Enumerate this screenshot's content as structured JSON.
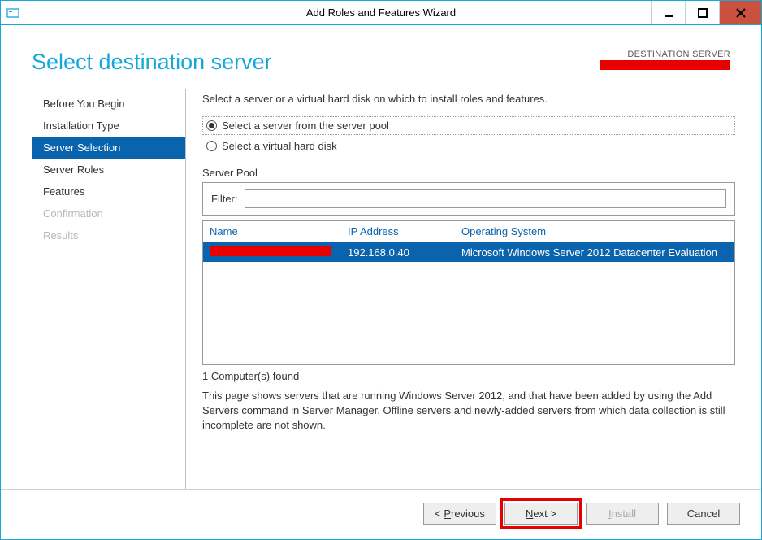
{
  "window": {
    "title": "Add Roles and Features Wizard"
  },
  "header": {
    "page_title": "Select destination server",
    "dest_label": "DESTINATION SERVER"
  },
  "nav": {
    "items": [
      {
        "label": "Before You Begin",
        "state": "normal"
      },
      {
        "label": "Installation Type",
        "state": "normal"
      },
      {
        "label": "Server Selection",
        "state": "selected"
      },
      {
        "label": "Server Roles",
        "state": "normal"
      },
      {
        "label": "Features",
        "state": "normal"
      },
      {
        "label": "Confirmation",
        "state": "disabled"
      },
      {
        "label": "Results",
        "state": "disabled"
      }
    ]
  },
  "pane": {
    "instruction": "Select a server or a virtual hard disk on which to install roles and features.",
    "radio1": "Select a server from the server pool",
    "radio2": "Select a virtual hard disk",
    "pool_label": "Server Pool",
    "filter_label": "Filter:",
    "filter_value": "",
    "columns": {
      "name": "Name",
      "ip": "IP Address",
      "os": "Operating System"
    },
    "row": {
      "ip": "192.168.0.40",
      "os": "Microsoft Windows Server 2012 Datacenter Evaluation"
    },
    "found": "1 Computer(s) found",
    "description": "This page shows servers that are running Windows Server 2012, and that have been added by using the Add Servers command in Server Manager. Offline servers and newly-added servers from which data collection is still incomplete are not shown."
  },
  "footer": {
    "previous": "< Previous",
    "next": "Next >",
    "install": "Install",
    "cancel": "Cancel"
  }
}
